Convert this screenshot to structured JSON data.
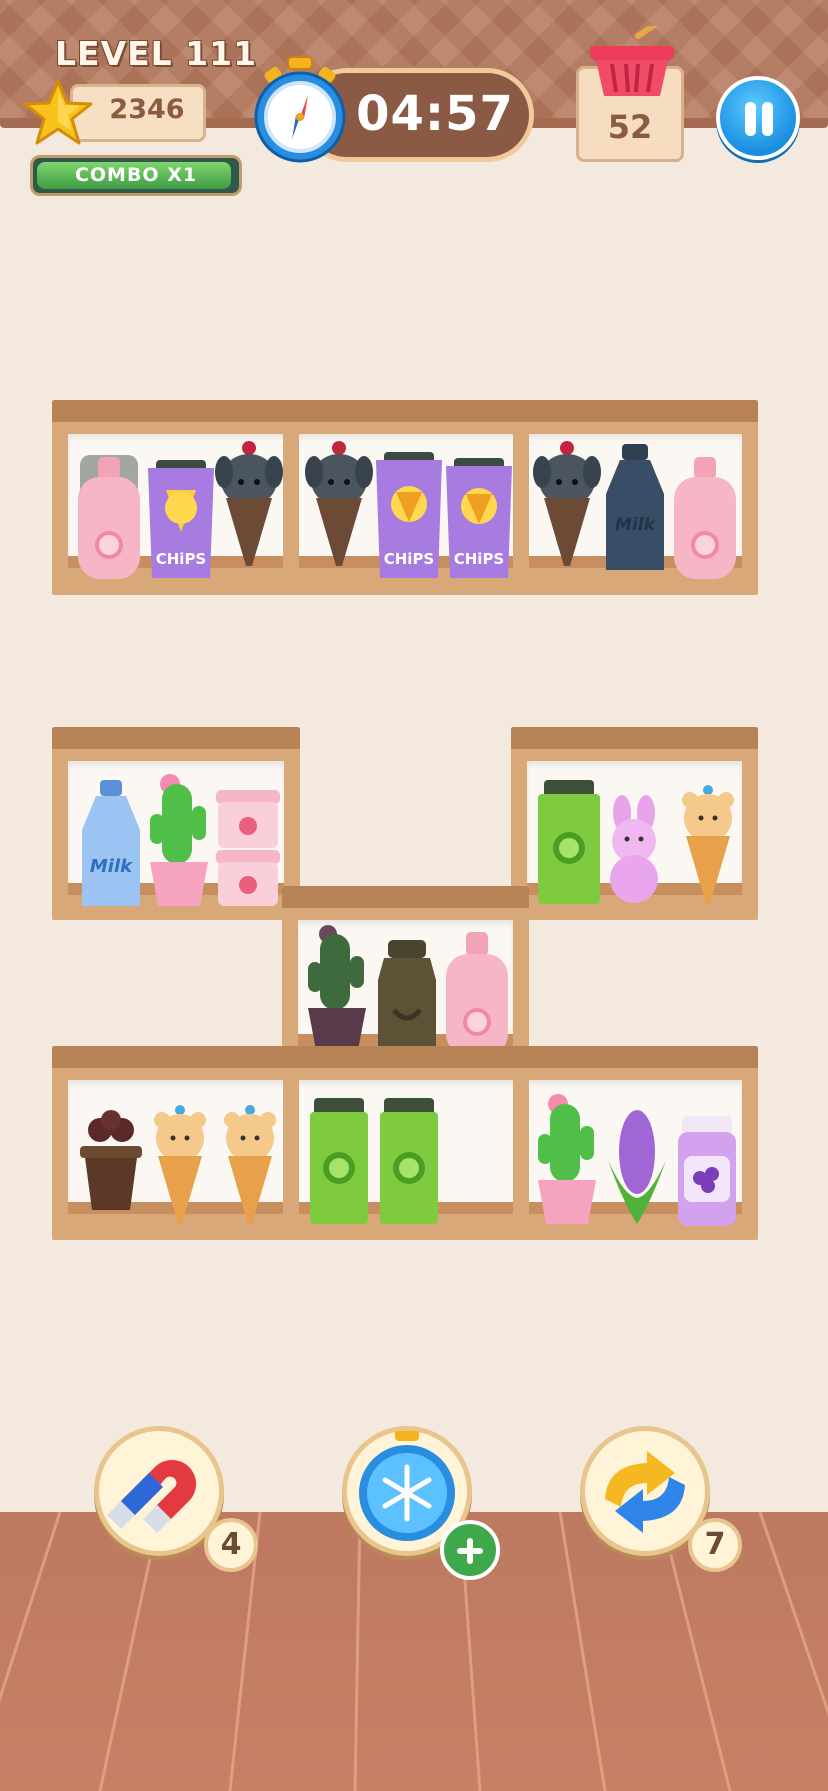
{
  "hud": {
    "level_label": "LEVEL 111",
    "score": "2346",
    "combo_label": "COMBO X1",
    "combo_progress": 0.98,
    "timer": "04:57",
    "basket_count": "52"
  },
  "boosters": [
    {
      "name": "magnet",
      "count": "4"
    },
    {
      "name": "freeze",
      "badge": "plus"
    },
    {
      "name": "shuffle",
      "count": "7"
    }
  ],
  "shelf_items": {
    "chips_label": "CHiPS",
    "milk_label": "Milk"
  },
  "colors": {
    "accent_blue": "#1a8fe0",
    "wood": "#d9a878",
    "wood_dark": "#b88257",
    "floor": "#c78066",
    "background": "#f3e9df"
  }
}
